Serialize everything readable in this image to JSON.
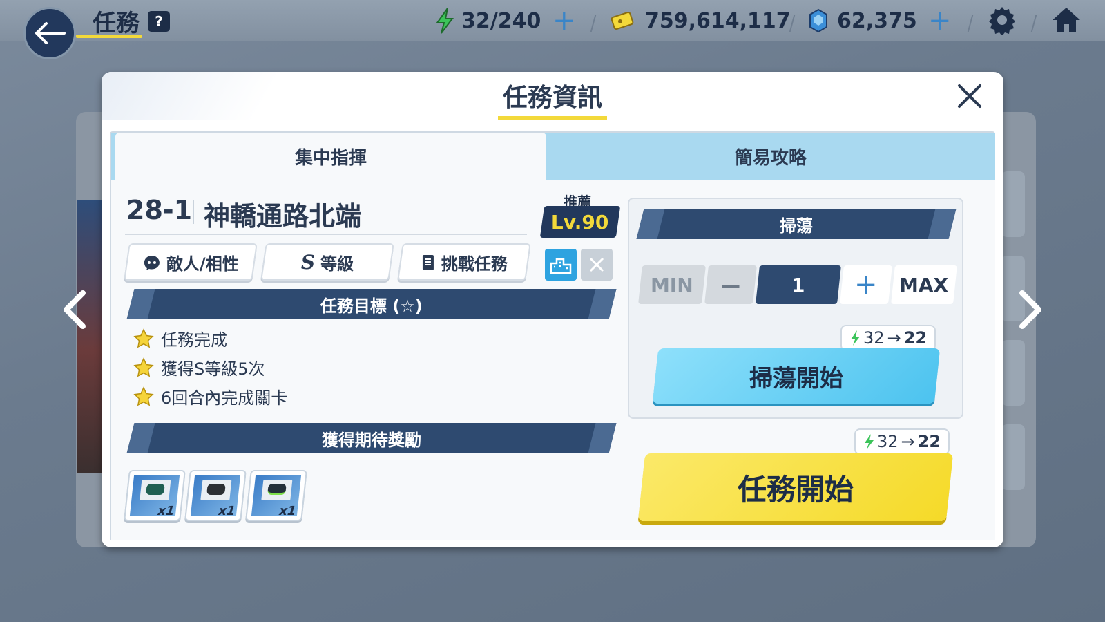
{
  "topbar": {
    "title": "任務",
    "help": "?",
    "ap": "32/240",
    "credits": "759,614,117",
    "gems": "62,375"
  },
  "modal": {
    "title": "任務資訊",
    "tabs": [
      {
        "label": "集中指揮",
        "active": true
      },
      {
        "label": "簡易攻略",
        "active": false
      }
    ],
    "stage": {
      "id": "28-1",
      "name": "神轎通路北端",
      "recommend_label": "推薦",
      "recommend_level": "Lv.90"
    },
    "info_buttons": [
      {
        "label": "敵人/相性",
        "icon": "enemy-icon"
      },
      {
        "label": "等級",
        "icon": "rank-s-icon",
        "icon_text": "S"
      },
      {
        "label": "挑戰任務",
        "icon": "notebook-icon"
      }
    ],
    "goals_header": "任務目標 (☆)",
    "goals": [
      "任務完成",
      "獲得S等級5次",
      "6回合內完成關卡"
    ],
    "rewards_header": "獲得期待獎勵",
    "rewards": [
      {
        "qty": "x1",
        "icon": "shoes-green-icon"
      },
      {
        "qty": "x1",
        "icon": "shoes-dark-icon"
      },
      {
        "qty": "x1",
        "icon": "shoes-striped-icon"
      }
    ],
    "sweep": {
      "header": "掃蕩",
      "min_label": "MIN",
      "minus_label": "—",
      "count": "1",
      "plus_label": "+",
      "max_label": "MAX",
      "cost_from": "32",
      "cost_to": "22",
      "start_label": "掃蕩開始"
    },
    "mission_start": {
      "cost_from": "32",
      "cost_to": "22",
      "label": "任務開始"
    }
  },
  "colors": {
    "navy": "#22385c",
    "accent_yellow": "#f3d93a",
    "sky_blue": "#5cc8f0",
    "ap_green": "#3cc45a"
  }
}
